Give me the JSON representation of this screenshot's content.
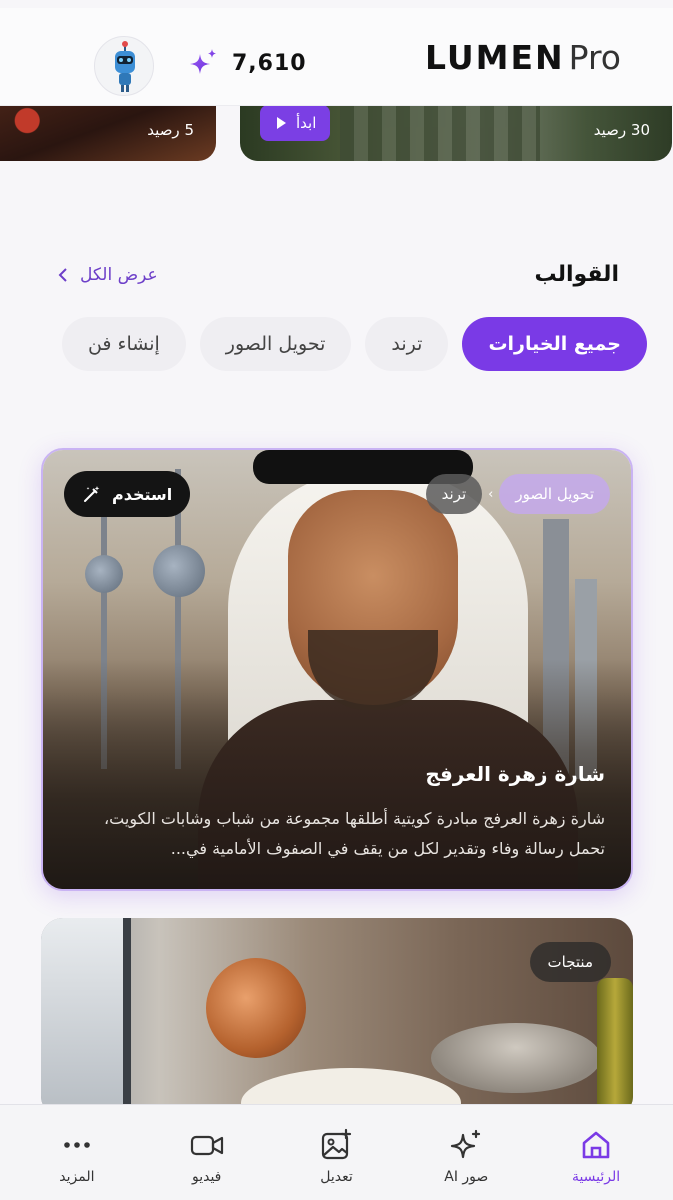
{
  "header": {
    "brand_main": "LUMEN",
    "brand_sub": "Pro",
    "credits": "7,610",
    "icons": {
      "credits": "sparkles-icon",
      "avatar": "robot-avatar"
    }
  },
  "top_carousel": [
    {
      "price": "5 رصيد"
    },
    {
      "price": "30 رصيد",
      "start_label": "ابدأ"
    }
  ],
  "templates_section": {
    "title": "القوالب",
    "see_all": "عرض الكل"
  },
  "filters": [
    "جميع الخيارات",
    "ترند",
    "تحويل الصور",
    "إنشاء فن"
  ],
  "cards": [
    {
      "tags": [
        "ترند",
        "تحويل الصور"
      ],
      "use_label": "استخدم",
      "title": "شارة زهرة العرفج",
      "description": "شارة زهرة العرفج مبادرة كويتية أطلقها مجموعة من شباب وشابات الكويت، تحمل رسالة وفاء وتقدير لكل من يقف في الصفوف الأمامية في..."
    },
    {
      "tags": [
        "منتجات"
      ]
    }
  ],
  "bottom_nav": [
    {
      "label": "الرئيسية",
      "icon": "home-icon",
      "active": true
    },
    {
      "label": "صور AI",
      "icon": "sparkles-icon",
      "active": false
    },
    {
      "label": "تعديل",
      "icon": "image-edit-icon",
      "active": false
    },
    {
      "label": "فيديو",
      "icon": "video-camera-icon",
      "active": false
    },
    {
      "label": "المزيد",
      "icon": "more-dots-icon",
      "active": false
    }
  ],
  "colors": {
    "accent": "#7a3ae6",
    "accent_light": "#c9b3f3"
  }
}
